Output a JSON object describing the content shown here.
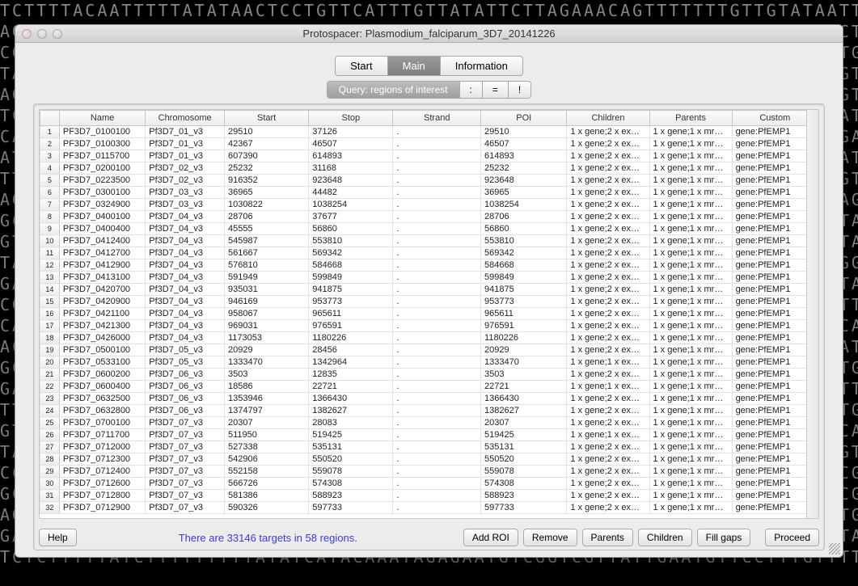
{
  "dna_background": "TCTTTTACAATTTTTATATAACTCCTGTTCATTTGTTATATTCTTAGAAACAGTTTTTTTGTTGTATAATTTATA\nAGCTGGTGTGCATACGGTGAGCGCCTATGCAAAATAGCCTCATACAAATAAATAAGCATCATCTCATCTCTCGCC\nCGGCGCCAACGACCAGAAGTAAAATTAGGTTGGTGATATAAACAGATGAAAAGGATCTGAAGGTATCAGTGATAA\nTAGGCCGGATGTGGATCAGTGATAGAGAGTGAATCGAAGAATAAATCACGTCGCTAGGATCTACCAGACGTGAAA\nAGAAACATCCACTGACGAAGGTGTTTGGCATACTAGGTACCTTGCGCCGAAGGACAGAGCAGCAGTGGAGTCACG\nTCTAGTGCGTGACTCCGGATGCCTTACTTAGCCTACTAAGACCATTGAAGACACTAGCTATGGTGAATGATGTAC\nCATAGTAGAAAAGCATTGAAAGATTTAACTTTAGAGCTGTAAAATACATAGTAATTTGAACATTGAGAGGATTTA\nATATGGATGTCTTAAGCGATAGATATCTTTTCTGAATTCAGTAAAGATAAATATGGCGAAAGATCACAAATATGT\nTTTAGTGGGATCGGGCACCAGGGGCATGTATACACGGTCACTTTAAAGATAGAAGAAGGTGCCTCCGCGGTCATG\nAGGTATATGACAAGCCCGCTGTATCTGTACGGGTGATCTTCTTAACTTTGTGAATTTCACCCGGTATCGAGTCGA\nGCTCGTTTTCCTTATCTGGCAGAATGCACAAACCGGCATGTATGTGCAGACTCCCTCGTCGGAGGCAATTATACG\nGTTTGCCGCATCTGTATATCAATTGGTACCTTGTCGCTGTAGATGTCCTAGTTCGTGGTTCACCCCAATTAATCA\nTAGCGAGACTGTGACCAAATTTCTTCATAGCGGAAACCTGGCAGATAGTTACTCGCAGGTTGTCATAAAGGCCCA\nGATGGAGAGCAGGTAGGGCAGCGAAAACAAATGGGACGGATTGATCGACCTAGATCAGAACCTTGCTCATAGGCT\nCGCCCTCACGTATCATGTTCTCAAGGCTGGCTAGCGTTCGACGCAGGTAGGCTTCGCCTCCGTACGCCGTTCCTA\nCAGGGGGCACGAATAGAATGGTCATCAGTCATATATTTGGCTGGCCGGTACCCATTGGTCGACTCATCTCACTGG\nACGACAACCTGATAGTCCTTGCTAAGGTAGTCGCGCATAGTGTACTCAGCGGGGAATACCTCTCCCAATATCTTC\nGCTTCTACAGAATCTCCATTAGCCTGCATTGAGTTACTGCCAGCCACTTCGGAGTGATCCGTAAGAATCTGGGTA\nGATCACGTTATAGTACATTTCTTTAGCATTATTAGCACCTTTTGTGAATACCATGAGCACTATGAGCACTTGCTC\nTTCTCGTAAATAGTATGAAAGTGATAGAACTAGGGAACAATACCTGTCAACTAAGATCCAAGATTCGCCTGACGG\nGTAAGAATGGCATCCGCTTGCAGGGTAGATAGCTCCTGAAGTATTACTAACGCCACCATTGAGAGCGTGCAGGCG\nTATACGAACAGGCATCTCGCTAGAACTCACGTGGCACATAGTGGATCTGATGCCTAAGGCCCGTAGAGGGTTACC\nCCAAACAATAGGAGAATCATACGGTGAAAAAGTCACGATGAGCATCGAGCATTACGATAAGAGAATCGTCGTAAC\nGCGATAAATTGCAATGATCAACAAGCACATACGCCAGTTCAGCATACCCGGCTTCAACAGCCCCCTAGTCGGTGC\nAGTAACCACCTTAAACCGAAGCATAGGATGAGCCATAAGTAGTCCTAAAACAGCTGCAAAGGCCACCATTGTTCC\nGATAACTCCTCGAAGAACCGAAAAACTCCACCCACGAGGTGCACCGGCACGCGCCAAAGACCTAAACGCTATGGA\nTCTCTTTTTATCTTTTTTTTTATATCATACAAATAGAGAATGTCGGTCGTTATTGAATGTTCCTTTGTTTTCAAA",
  "window": {
    "title": "Protospacer: Plasmodium_falciparum_3D7_20141226"
  },
  "tabs": {
    "start": "Start",
    "main": "Main",
    "info": "Information"
  },
  "query": {
    "label": "Query: regions of interest",
    "colon": ":",
    "eq": "=",
    "bang": "!"
  },
  "columns": {
    "name": "Name",
    "chromosome": "Chromosome",
    "start": "Start",
    "stop": "Stop",
    "strand": "Strand",
    "poi": "POI",
    "children": "Children",
    "parents": "Parents",
    "custom": "Custom"
  },
  "rows": [
    {
      "n": "1",
      "name": "PF3D7_0100100",
      "chr": "Pf3D7_01_v3",
      "start": "29510",
      "stop": "37126",
      "strand": ".",
      "poi": "29510",
      "children": "1 x gene;2 x ex…",
      "parents": "1 x gene;1 x mr…",
      "custom": "gene:PfEMP1"
    },
    {
      "n": "2",
      "name": "PF3D7_0100300",
      "chr": "Pf3D7_01_v3",
      "start": "42367",
      "stop": "46507",
      "strand": ".",
      "poi": "46507",
      "children": "1 x gene;2 x ex…",
      "parents": "1 x gene;1 x mr…",
      "custom": "gene:PfEMP1"
    },
    {
      "n": "3",
      "name": "PF3D7_0115700",
      "chr": "Pf3D7_01_v3",
      "start": "607390",
      "stop": "614893",
      "strand": ".",
      "poi": "614893",
      "children": "1 x gene;2 x ex…",
      "parents": "1 x gene;1 x mr…",
      "custom": "gene:PfEMP1"
    },
    {
      "n": "4",
      "name": "PF3D7_0200100",
      "chr": "Pf3D7_02_v3",
      "start": "25232",
      "stop": "31168",
      "strand": ".",
      "poi": "25232",
      "children": "1 x gene;2 x ex…",
      "parents": "1 x gene;1 x mr…",
      "custom": "gene:PfEMP1"
    },
    {
      "n": "5",
      "name": "PF3D7_0223500",
      "chr": "Pf3D7_02_v3",
      "start": "916352",
      "stop": "923648",
      "strand": ".",
      "poi": "923648",
      "children": "1 x gene;2 x ex…",
      "parents": "1 x gene;1 x mr…",
      "custom": "gene:PfEMP1"
    },
    {
      "n": "6",
      "name": "PF3D7_0300100",
      "chr": "Pf3D7_03_v3",
      "start": "36965",
      "stop": "44482",
      "strand": ".",
      "poi": "36965",
      "children": "1 x gene;2 x ex…",
      "parents": "1 x gene;1 x mr…",
      "custom": "gene:PfEMP1"
    },
    {
      "n": "7",
      "name": "PF3D7_0324900",
      "chr": "Pf3D7_03_v3",
      "start": "1030822",
      "stop": "1038254",
      "strand": ".",
      "poi": "1038254",
      "children": "1 x gene;2 x ex…",
      "parents": "1 x gene;1 x mr…",
      "custom": "gene:PfEMP1"
    },
    {
      "n": "8",
      "name": "PF3D7_0400100",
      "chr": "Pf3D7_04_v3",
      "start": "28706",
      "stop": "37677",
      "strand": ".",
      "poi": "28706",
      "children": "1 x gene;2 x ex…",
      "parents": "1 x gene;1 x mr…",
      "custom": "gene:PfEMP1"
    },
    {
      "n": "9",
      "name": "PF3D7_0400400",
      "chr": "Pf3D7_04_v3",
      "start": "45555",
      "stop": "56860",
      "strand": ".",
      "poi": "56860",
      "children": "1 x gene;2 x ex…",
      "parents": "1 x gene;1 x mr…",
      "custom": "gene:PfEMP1"
    },
    {
      "n": "10",
      "name": "PF3D7_0412400",
      "chr": "Pf3D7_04_v3",
      "start": "545987",
      "stop": "553810",
      "strand": ".",
      "poi": "553810",
      "children": "1 x gene;2 x ex…",
      "parents": "1 x gene;1 x mr…",
      "custom": "gene:PfEMP1"
    },
    {
      "n": "11",
      "name": "PF3D7_0412700",
      "chr": "Pf3D7_04_v3",
      "start": "561667",
      "stop": "569342",
      "strand": ".",
      "poi": "569342",
      "children": "1 x gene;2 x ex…",
      "parents": "1 x gene;1 x mr…",
      "custom": "gene:PfEMP1"
    },
    {
      "n": "12",
      "name": "PF3D7_0412900",
      "chr": "Pf3D7_04_v3",
      "start": "576810",
      "stop": "584668",
      "strand": ".",
      "poi": "584668",
      "children": "1 x gene;2 x ex…",
      "parents": "1 x gene;1 x mr…",
      "custom": "gene:PfEMP1"
    },
    {
      "n": "13",
      "name": "PF3D7_0413100",
      "chr": "Pf3D7_04_v3",
      "start": "591949",
      "stop": "599849",
      "strand": ".",
      "poi": "599849",
      "children": "1 x gene;2 x ex…",
      "parents": "1 x gene;1 x mr…",
      "custom": "gene:PfEMP1"
    },
    {
      "n": "14",
      "name": "PF3D7_0420700",
      "chr": "Pf3D7_04_v3",
      "start": "935031",
      "stop": "941875",
      "strand": ".",
      "poi": "941875",
      "children": "1 x gene;2 x ex…",
      "parents": "1 x gene;1 x mr…",
      "custom": "gene:PfEMP1"
    },
    {
      "n": "15",
      "name": "PF3D7_0420900",
      "chr": "Pf3D7_04_v3",
      "start": "946169",
      "stop": "953773",
      "strand": ".",
      "poi": "953773",
      "children": "1 x gene;2 x ex…",
      "parents": "1 x gene;1 x mr…",
      "custom": "gene:PfEMP1"
    },
    {
      "n": "16",
      "name": "PF3D7_0421100",
      "chr": "Pf3D7_04_v3",
      "start": "958067",
      "stop": "965611",
      "strand": ".",
      "poi": "965611",
      "children": "1 x gene;2 x ex…",
      "parents": "1 x gene;1 x mr…",
      "custom": "gene:PfEMP1"
    },
    {
      "n": "17",
      "name": "PF3D7_0421300",
      "chr": "Pf3D7_04_v3",
      "start": "969031",
      "stop": "976591",
      "strand": ".",
      "poi": "976591",
      "children": "1 x gene;2 x ex…",
      "parents": "1 x gene;1 x mr…",
      "custom": "gene:PfEMP1"
    },
    {
      "n": "18",
      "name": "PF3D7_0426000",
      "chr": "Pf3D7_04_v3",
      "start": "1173053",
      "stop": "1180226",
      "strand": ".",
      "poi": "1180226",
      "children": "1 x gene;2 x ex…",
      "parents": "1 x gene;1 x mr…",
      "custom": "gene:PfEMP1"
    },
    {
      "n": "19",
      "name": "PF3D7_0500100",
      "chr": "Pf3D7_05_v3",
      "start": "20929",
      "stop": "28456",
      "strand": ".",
      "poi": "20929",
      "children": "1 x gene;2 x ex…",
      "parents": "1 x gene;1 x mr…",
      "custom": "gene:PfEMP1"
    },
    {
      "n": "20",
      "name": "PF3D7_0533100",
      "chr": "Pf3D7_05_v3",
      "start": "1333470",
      "stop": "1342964",
      "strand": ".",
      "poi": "1333470",
      "children": "1 x gene;1 x ex…",
      "parents": "1 x gene;1 x mr…",
      "custom": "gene:PfEMP1"
    },
    {
      "n": "21",
      "name": "PF3D7_0600200",
      "chr": "Pf3D7_06_v3",
      "start": "3503",
      "stop": "12835",
      "strand": ".",
      "poi": "3503",
      "children": "1 x gene;2 x ex…",
      "parents": "1 x gene;1 x mr…",
      "custom": "gene:PfEMP1"
    },
    {
      "n": "22",
      "name": "PF3D7_0600400",
      "chr": "Pf3D7_06_v3",
      "start": "18586",
      "stop": "22721",
      "strand": ".",
      "poi": "22721",
      "children": "1 x gene;1 x ex…",
      "parents": "1 x gene;1 x mr…",
      "custom": "gene:PfEMP1"
    },
    {
      "n": "23",
      "name": "PF3D7_0632500",
      "chr": "Pf3D7_06_v3",
      "start": "1353946",
      "stop": "1366430",
      "strand": ".",
      "poi": "1366430",
      "children": "1 x gene;2 x ex…",
      "parents": "1 x gene;1 x mr…",
      "custom": "gene:PfEMP1"
    },
    {
      "n": "24",
      "name": "PF3D7_0632800",
      "chr": "Pf3D7_06_v3",
      "start": "1374797",
      "stop": "1382627",
      "strand": ".",
      "poi": "1382627",
      "children": "1 x gene;2 x ex…",
      "parents": "1 x gene;1 x mr…",
      "custom": "gene:PfEMP1"
    },
    {
      "n": "25",
      "name": "PF3D7_0700100",
      "chr": "Pf3D7_07_v3",
      "start": "20307",
      "stop": "28083",
      "strand": ".",
      "poi": "20307",
      "children": "1 x gene;2 x ex…",
      "parents": "1 x gene;1 x mr…",
      "custom": "gene:PfEMP1"
    },
    {
      "n": "26",
      "name": "PF3D7_0711700",
      "chr": "Pf3D7_07_v3",
      "start": "511950",
      "stop": "519425",
      "strand": ".",
      "poi": "519425",
      "children": "1 x gene;1 x ex…",
      "parents": "1 x gene;1 x mr…",
      "custom": "gene:PfEMP1"
    },
    {
      "n": "27",
      "name": "PF3D7_0712000",
      "chr": "Pf3D7_07_v3",
      "start": "527338",
      "stop": "535131",
      "strand": ".",
      "poi": "535131",
      "children": "1 x gene;2 x ex…",
      "parents": "1 x gene;1 x mr…",
      "custom": "gene:PfEMP1"
    },
    {
      "n": "28",
      "name": "PF3D7_0712300",
      "chr": "Pf3D7_07_v3",
      "start": "542906",
      "stop": "550520",
      "strand": ".",
      "poi": "550520",
      "children": "1 x gene;2 x ex…",
      "parents": "1 x gene;1 x mr…",
      "custom": "gene:PfEMP1"
    },
    {
      "n": "29",
      "name": "PF3D7_0712400",
      "chr": "Pf3D7_07_v3",
      "start": "552158",
      "stop": "559078",
      "strand": ".",
      "poi": "559078",
      "children": "1 x gene;2 x ex…",
      "parents": "1 x gene;1 x mr…",
      "custom": "gene:PfEMP1"
    },
    {
      "n": "30",
      "name": "PF3D7_0712600",
      "chr": "Pf3D7_07_v3",
      "start": "566726",
      "stop": "574308",
      "strand": ".",
      "poi": "574308",
      "children": "1 x gene;2 x ex…",
      "parents": "1 x gene;1 x mr…",
      "custom": "gene:PfEMP1"
    },
    {
      "n": "31",
      "name": "PF3D7_0712800",
      "chr": "Pf3D7_07_v3",
      "start": "581386",
      "stop": "588923",
      "strand": ".",
      "poi": "588923",
      "children": "1 x gene;2 x ex…",
      "parents": "1 x gene;1 x mr…",
      "custom": "gene:PfEMP1"
    },
    {
      "n": "32",
      "name": "PF3D7_0712900",
      "chr": "Pf3D7_07_v3",
      "start": "590326",
      "stop": "597733",
      "strand": ".",
      "poi": "597733",
      "children": "1 x gene;2 x ex…",
      "parents": "1 x gene;1 x mr…",
      "custom": "gene:PfEMP1"
    }
  ],
  "footer": {
    "help": "Help",
    "status": "There are 33146 targets in 58 regions.",
    "add_roi": "Add ROI",
    "remove": "Remove",
    "parents": "Parents",
    "children": "Children",
    "fill_gaps": "Fill gaps",
    "proceed": "Proceed"
  }
}
